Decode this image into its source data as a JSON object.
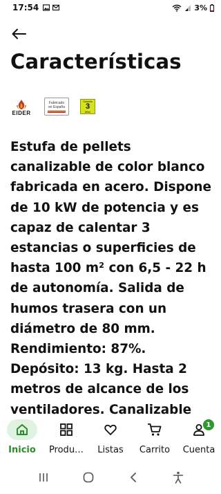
{
  "status_bar": {
    "time": "17:54",
    "battery": "3%",
    "left_icons": [
      "image-icon",
      "gmail-icon"
    ],
    "right_icons": [
      "wifi-icon",
      "signal-icon",
      "battery-icon"
    ]
  },
  "header": {
    "title": "Características"
  },
  "logos": {
    "eider": "EIDER",
    "fabricado_line1": "Fabricado",
    "fabricado_line2": "en España",
    "garantia_top": "Garantía",
    "garantia_num": "3",
    "garantia_bot": "Años"
  },
  "description": {
    "lines": [
      "Estufa de pellets",
      "canalizable de color blanco",
      "fabricada en acero. Dispone",
      "de 10 kW de potencia y es",
      "capaz de calentar 3",
      "estancias o superficies de",
      "hasta 100 m² con 6,5 - 22 h",
      "de autonomía. Salida de",
      "humos trasera con un",
      "diámetro de 80 mm.",
      "Rendimiento: 87%.",
      "Depósito: 13 kg. Hasta 2",
      "metros de alcance de los",
      "ventiladores. Canalizable"
    ]
  },
  "bottom_nav": {
    "items": [
      {
        "label": "Inicio",
        "icon": "home-icon",
        "active": true
      },
      {
        "label": "Produ…",
        "icon": "grid-icon",
        "active": false
      },
      {
        "label": "Listas",
        "icon": "heart-icon",
        "active": false
      },
      {
        "label": "Carrito",
        "icon": "cart-icon",
        "active": false
      },
      {
        "label": "Cuenta",
        "icon": "user-icon",
        "active": false,
        "badge": "1"
      }
    ]
  },
  "colors": {
    "accent_green": "#2c8c2c",
    "active_pill": "#dff2df",
    "badge_green": "#2c9a2c"
  }
}
